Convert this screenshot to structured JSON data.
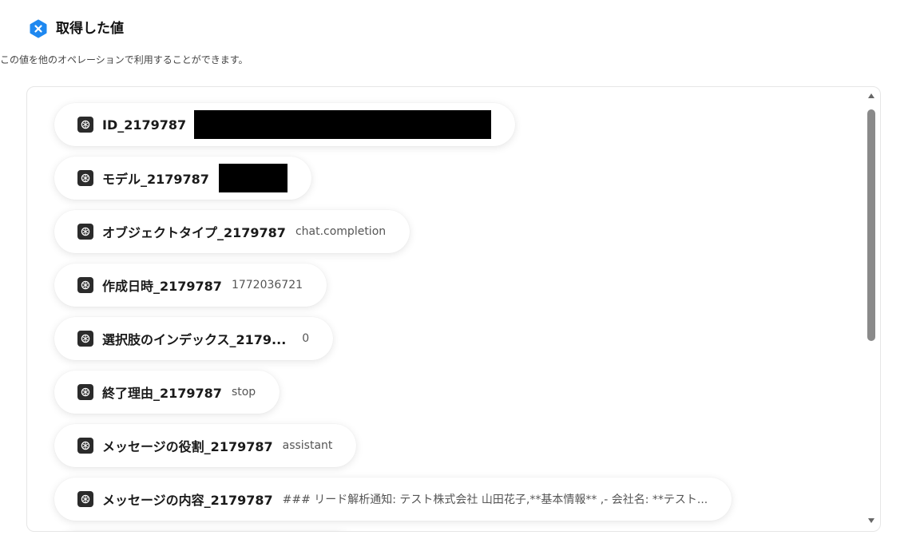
{
  "header": {
    "title": "取得した値",
    "icon": "x-badge-icon",
    "icon_color": "#1e88f0"
  },
  "subtitle": "この値を他のオペレーションで利用することができます。",
  "items": [
    {
      "label": "ID_2179787",
      "value": "",
      "redacted": true,
      "icon": "openai-icon"
    },
    {
      "label": "モデル_2179787",
      "value": "",
      "redacted": true,
      "icon": "openai-icon"
    },
    {
      "label": "オブジェクトタイプ_2179787",
      "value": "chat.completion",
      "icon": "openai-icon"
    },
    {
      "label": "作成日時_2179787",
      "value": "1772036721",
      "icon": "openai-icon"
    },
    {
      "label": "選択肢のインデックス_2179...",
      "value": "0",
      "icon": "openai-icon"
    },
    {
      "label": "終了理由_2179787",
      "value": "stop",
      "icon": "openai-icon"
    },
    {
      "label": "メッセージの役割_2179787",
      "value": "assistant",
      "icon": "openai-icon"
    },
    {
      "label": "メッセージの内容_2179787",
      "value": "### リード解析通知: テスト株式会社 山田花子,**基本情報** ,- 会社名: **テスト...",
      "icon": "openai-icon"
    }
  ]
}
